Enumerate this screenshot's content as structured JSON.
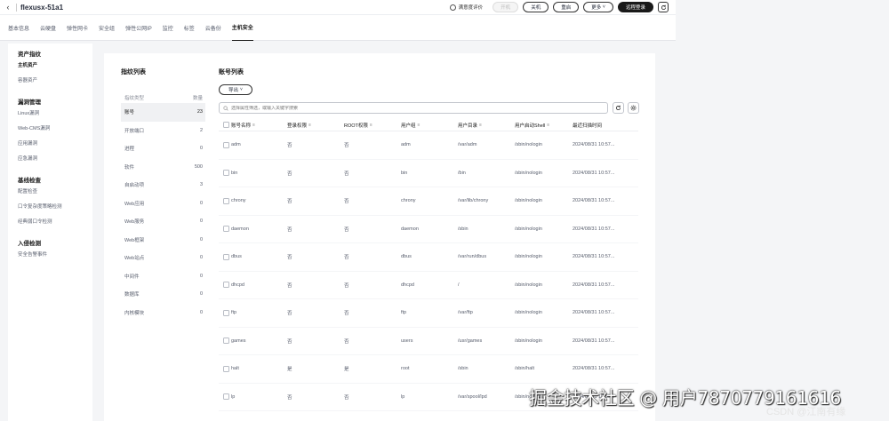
{
  "header": {
    "title": "flexusx-51a1",
    "feedback": "满意度评价",
    "buttons": {
      "disabled": "开机",
      "shutdown": "关机",
      "restart": "重启",
      "more": "更多",
      "remote": "远程登录"
    }
  },
  "tabs": [
    "基本信息",
    "云硬盘",
    "弹性网卡",
    "安全组",
    "弹性公网IP",
    "监控",
    "标签",
    "云备份",
    "主机安全"
  ],
  "sidebar": {
    "groups": [
      {
        "title": "资产指纹",
        "items": [
          "主机资产",
          "容器资产"
        ]
      },
      {
        "title": "漏洞管理",
        "items": [
          "Linux漏洞",
          "Web-CMS漏洞",
          "应用漏洞",
          "应急漏洞"
        ]
      },
      {
        "title": "基线检查",
        "items": [
          "配置检查",
          "口令复杂度策略检测",
          "经典弱口令检测"
        ]
      },
      {
        "title": "入侵检测",
        "items": [
          "安全告警事件"
        ]
      }
    ]
  },
  "fingerprint": {
    "title": "指纹列表",
    "head_label": "指纹类型",
    "head_count": "数量",
    "items": [
      {
        "name": "账号",
        "count": "23"
      },
      {
        "name": "开放端口",
        "count": "2"
      },
      {
        "name": "进程",
        "count": "0"
      },
      {
        "name": "软件",
        "count": "500"
      },
      {
        "name": "自启动项",
        "count": "3"
      },
      {
        "name": "Web应用",
        "count": "0"
      },
      {
        "name": "Web服务",
        "count": "0"
      },
      {
        "name": "Web框架",
        "count": "0"
      },
      {
        "name": "Web站点",
        "count": "0"
      },
      {
        "name": "中间件",
        "count": "0"
      },
      {
        "name": "数据库",
        "count": "0"
      },
      {
        "name": "内核模块",
        "count": "0"
      }
    ]
  },
  "accounts": {
    "title": "账号列表",
    "export_label": "导出",
    "search_placeholder": "选择属性筛选，或输入关键字搜索",
    "columns": [
      "账号名称",
      "登录权限",
      "ROOT权限",
      "用户组",
      "用户目录",
      "用户启动Shell",
      "最近扫描时间"
    ],
    "rows": [
      [
        "adm",
        "否",
        "否",
        "adm",
        "/var/adm",
        "/sbin/nologin",
        "2024/08/31 10:57..."
      ],
      [
        "bin",
        "否",
        "否",
        "bin",
        "/bin",
        "/sbin/nologin",
        "2024/08/31 10:57..."
      ],
      [
        "chrony",
        "否",
        "否",
        "chrony",
        "/var/lib/chrony",
        "/sbin/nologin",
        "2024/08/31 10:57..."
      ],
      [
        "daemon",
        "否",
        "否",
        "daemon",
        "/sbin",
        "/sbin/nologin",
        "2024/08/31 10:57..."
      ],
      [
        "dbus",
        "否",
        "否",
        "dbus",
        "/var/run/dbus",
        "/sbin/nologin",
        "2024/08/31 10:57..."
      ],
      [
        "dhcpd",
        "否",
        "否",
        "dhcpd",
        "/",
        "/sbin/nologin",
        "2024/08/31 10:57..."
      ],
      [
        "ftp",
        "否",
        "否",
        "ftp",
        "/var/ftp",
        "/sbin/nologin",
        "2024/08/31 10:57..."
      ],
      [
        "games",
        "否",
        "否",
        "users",
        "/usr/games",
        "/sbin/nologin",
        "2024/08/31 10:57..."
      ],
      [
        "halt",
        "是",
        "是",
        "root",
        "/sbin",
        "/sbin/halt",
        "2024/08/31 10:57..."
      ],
      [
        "lp",
        "否",
        "否",
        "lp",
        "/var/spool/lpd",
        "/sbin/nologin",
        "2024/08/31 10:57..."
      ]
    ]
  },
  "watermark": {
    "main": "掘金技术社区 @ 用户787077916161​6",
    "sub": "CSDN @江南有缘"
  }
}
